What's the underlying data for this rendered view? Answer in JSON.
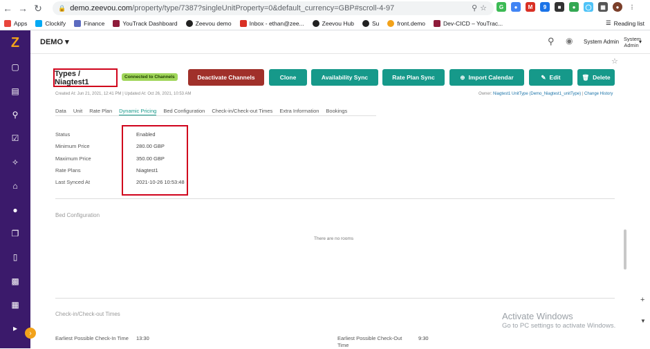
{
  "browser": {
    "url_host": "demo.zeevou.com",
    "url_path": "/property/type/7387?singleUnitProperty=0&default_currency=GBP#scroll-4-97",
    "bookmarks": [
      {
        "label": "Apps",
        "color": "#e8453c"
      },
      {
        "label": "Clockify",
        "color": "#03a9f4"
      },
      {
        "label": "Finance",
        "color": "#5c6bc0"
      },
      {
        "label": "YouTrack Dashboard",
        "color": "#8e1b3a"
      },
      {
        "label": "Zeevou demo",
        "color": "#222222"
      },
      {
        "label": "Inbox - ethan@zee...",
        "color": "#d93025"
      },
      {
        "label": "Zeevou Hub",
        "color": "#222222"
      },
      {
        "label": "Su",
        "color": "#222222"
      },
      {
        "label": "front.demo",
        "color": "#f2a21a"
      },
      {
        "label": "Dev-CICD – YouTrac...",
        "color": "#8e1b3a"
      }
    ],
    "reading_list": "Reading list"
  },
  "topbar": {
    "brand": "DEMO",
    "user": "System Admin",
    "avatar_alt": "System Admin"
  },
  "header": {
    "title": "Types / Niagtest1",
    "status_badge": "Connected to Channels",
    "buttons": {
      "deactivate": "Deactivate Channels",
      "clone": "Clone",
      "availability": "Availability Sync",
      "rateplan": "Rate Plan Sync",
      "import": "Import Calendar",
      "edit": "Edit",
      "delete": "Delete"
    },
    "meta": "Created At: Jun 21, 2021, 12:41 PM  |  Updated At: Oct 26, 2021, 10:53 AM",
    "owner_label": "Owner:",
    "owner_value": "Niagtest1 UnitType (Demo_Niagtest1_unitType)",
    "change_history": "Change History"
  },
  "tabs": [
    "Data",
    "Unit",
    "Rate Plan",
    "Dynamic Pricing",
    "Bed Configuration",
    "Check-in/Check-out Times",
    "Extra Information",
    "Bookings"
  ],
  "dynamic_pricing": {
    "status_label": "Status",
    "status_value": "Enabled",
    "min_label": "Minimum Price",
    "min_value": "280.00 GBP",
    "max_label": "Maximum Price",
    "max_value": "350.00 GBP",
    "rate_label": "Rate Plans",
    "rate_value": "Niagtest1",
    "synced_label": "Last Synced At",
    "synced_value": "2021-10-26 10:53:48"
  },
  "bed_config": {
    "title": "Bed Configuration",
    "empty": "There are no rooms"
  },
  "checkin": {
    "title": "Check-in/Check-out Times",
    "earliest_in_label": "Earliest Possible Check-In Time",
    "earliest_in_value": "13:30",
    "earliest_out_label": "Earliest Possible Check-Out Time",
    "earliest_out_value": "9:30"
  },
  "watermark": {
    "line1": "Activate Windows",
    "line2": "Go to PC settings to activate Windows."
  }
}
